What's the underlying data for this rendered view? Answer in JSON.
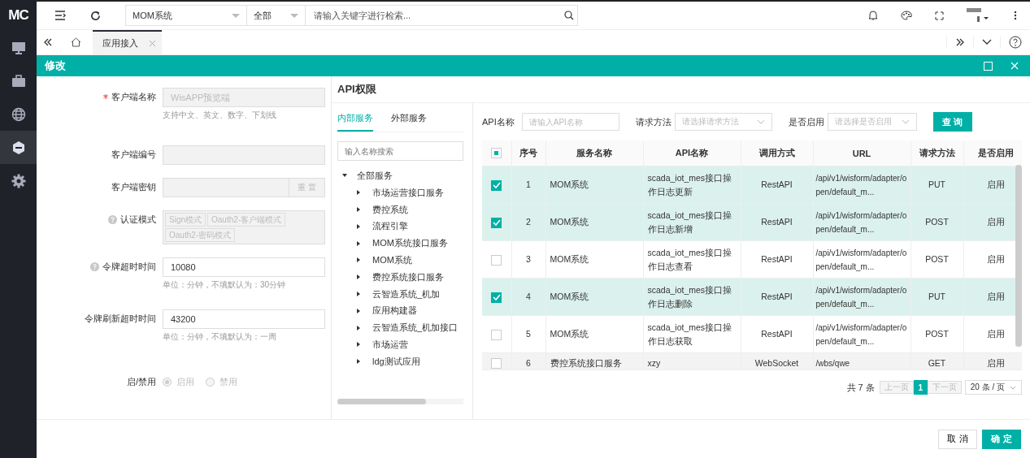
{
  "logo": "MC",
  "sidebar": [
    {
      "selected": false
    },
    {
      "selected": false
    },
    {
      "selected": false
    },
    {
      "selected": true
    },
    {
      "selected": false
    }
  ],
  "header": {
    "system_select": "MOM系统",
    "scope_select": "全部",
    "search": {
      "placeholder": "请输入关键字进行检索..."
    }
  },
  "tabs": [
    {
      "label": "应用接入",
      "selected": true
    }
  ],
  "dialog": {
    "title": "修改",
    "form": [
      {
        "kind": "text",
        "label": "客户端名称",
        "required": true,
        "help": false,
        "value": "WisAPP预览端",
        "disabled": true,
        "hint": "支持中文、英文、数字、下划线"
      },
      {
        "kind": "text",
        "label": "客户端编号",
        "required": false,
        "help": false,
        "disabled": true
      },
      {
        "kind": "secret",
        "label": "客户端密钥",
        "required": false,
        "help": false,
        "disabled": true,
        "button": "重 置"
      },
      {
        "kind": "tags",
        "label": "认证模式",
        "required": false,
        "help": true,
        "disabled": true,
        "tags": [
          "Sign模式",
          "Oauth2-客户端模式",
          "Oauth2-密码模式"
        ]
      },
      {
        "kind": "text",
        "label": "令牌超时时间",
        "required": false,
        "help": true,
        "value": "10080",
        "disabled": false,
        "hint": "单位：分钟，不填默认为：30分钟"
      },
      {
        "kind": "text",
        "label": "令牌刷新超时时间",
        "required": false,
        "help": false,
        "value": "43200",
        "disabled": false,
        "hint": "单位：分钟，不填默认为：一周"
      },
      {
        "kind": "radio",
        "label": "启/禁用",
        "required": false,
        "help": false,
        "disabled": true,
        "options": [
          {
            "label": "启用",
            "selected": true
          },
          {
            "label": "禁用",
            "selected": false
          }
        ]
      }
    ],
    "api_title": "API权限",
    "service_tabs": [
      {
        "label": "内部服务",
        "selected": true
      },
      {
        "label": "外部服务",
        "selected": false
      }
    ],
    "tree_search": {
      "placeholder": "输入名称搜索"
    },
    "tree": [
      {
        "label": "全部服务",
        "expanded": true,
        "children": [
          {
            "label": "市场运营接口服务",
            "expanded": false
          },
          {
            "label": "费控系统",
            "expanded": false
          },
          {
            "label": "流程引擎",
            "expanded": false
          },
          {
            "label": "MOM系统接口服务",
            "expanded": false
          },
          {
            "label": "MOM系统",
            "expanded": false
          },
          {
            "label": "费控系统接口服务",
            "expanded": false
          },
          {
            "label": "云智造系统_机加",
            "expanded": false
          },
          {
            "label": "应用构建器",
            "expanded": false
          },
          {
            "label": "云智造系统_机加接口",
            "expanded": false
          },
          {
            "label": "市场运营",
            "expanded": false
          },
          {
            "label": "ldg测试应用",
            "expanded": false
          }
        ]
      }
    ],
    "filters": [
      {
        "kind": "input",
        "label": "API名称",
        "placeholder": "请输入API名称"
      },
      {
        "kind": "select",
        "label": "请求方法",
        "placeholder": "请选择请求方法"
      },
      {
        "kind": "select",
        "label": "是否启用",
        "placeholder": "请选择是否启用"
      }
    ],
    "query_button": "查 询",
    "table": {
      "indeterminate": true,
      "columns": [
        "序号",
        "服务名称",
        "API名称",
        "调用方式",
        "URL",
        "请求方法",
        "是否启用"
      ],
      "rows": [
        {
          "checked": true,
          "cells": [
            "1",
            "MOM系统",
            "scada_iot_mes接口操作日志更新",
            "RestAPI",
            "/api/v1/wisform/adapter/open/default_m...",
            "PUT",
            "启用"
          ]
        },
        {
          "checked": true,
          "cells": [
            "2",
            "MOM系统",
            "scada_iot_mes接口操作日志新增",
            "RestAPI",
            "/api/v1/wisform/adapter/open/default_m...",
            "POST",
            "启用"
          ]
        },
        {
          "checked": false,
          "cells": [
            "3",
            "MOM系统",
            "scada_iot_mes接口操作日志查看",
            "RestAPI",
            "/api/v1/wisform/adapter/open/default_m...",
            "POST",
            "启用"
          ]
        },
        {
          "checked": true,
          "cells": [
            "4",
            "MOM系统",
            "scada_iot_mes接口操作日志删除",
            "RestAPI",
            "/api/v1/wisform/adapter/open/default_m...",
            "PUT",
            "启用"
          ]
        },
        {
          "checked": false,
          "cells": [
            "5",
            "MOM系统",
            "scada_iot_mes接口操作日志获取",
            "RestAPI",
            "/api/v1/wisform/adapter/open/default_m...",
            "POST",
            "启用"
          ]
        },
        {
          "checked": false,
          "cells": [
            "6",
            "费控系统接口服务",
            "xzy",
            "WebSocket",
            "/wbs/qwe",
            "GET",
            "启用"
          ]
        }
      ]
    },
    "pagination": {
      "total": "共 7 条",
      "prev": "上一页",
      "pages": [
        {
          "label": "1",
          "selected": true
        }
      ],
      "next": "下一页",
      "page_size": "20 条 / 页"
    },
    "buttons": [
      {
        "label": "取 消",
        "kind": "default"
      },
      {
        "label": "确 定",
        "kind": "primary"
      }
    ]
  }
}
